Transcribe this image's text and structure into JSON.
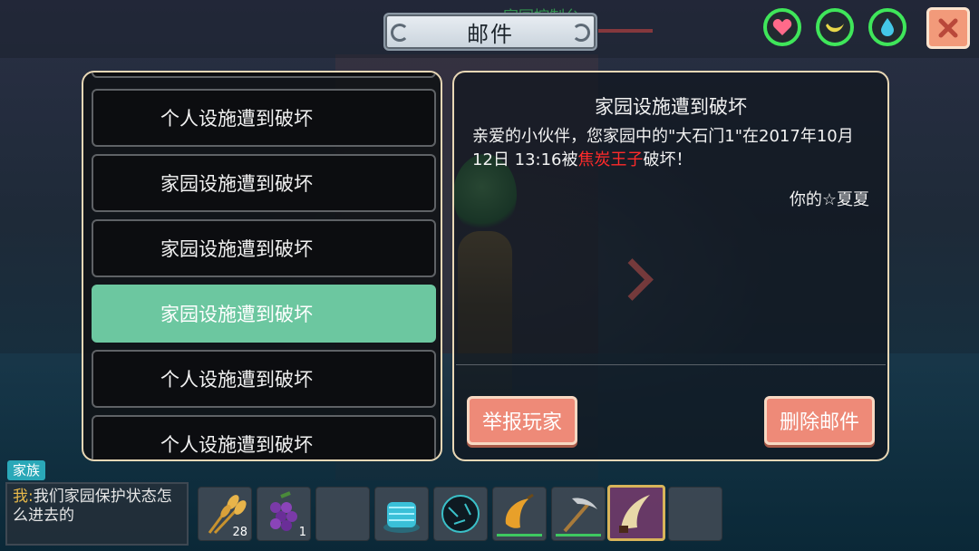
{
  "header": {
    "title": "邮件",
    "ghost_title": "家园控制台"
  },
  "status_icons": [
    "heart-icon",
    "banana-icon",
    "water-drop-icon"
  ],
  "close_icon": "close-x-icon",
  "mail_list": [
    {
      "label": "个人设施遭到破坏",
      "selected": false
    },
    {
      "label": "家园设施遭到破坏",
      "selected": false
    },
    {
      "label": "家园设施遭到破坏",
      "selected": false
    },
    {
      "label": "家园设施遭到破坏",
      "selected": true
    },
    {
      "label": "个人设施遭到破坏",
      "selected": false
    },
    {
      "label": "个人设施遭到破坏",
      "selected": false
    }
  ],
  "detail": {
    "title": "家园设施遭到破坏",
    "body_prefix": "亲爱的小伙伴，您家园中的\"大石门1\"在2017年10月12日 13:16被",
    "attacker": "焦炭王子",
    "body_suffix": "破坏！",
    "signature": "你的☆夏夏",
    "report_button": "举报玩家",
    "delete_button": "删除邮件"
  },
  "chat": {
    "channel": "家族",
    "sender": "我",
    "separator": ":",
    "message": "我们家园保护状态怎么进去的"
  },
  "hotbar": [
    {
      "icon": "wheat-icon",
      "count": "28"
    },
    {
      "icon": "grapes-icon",
      "count": "1"
    },
    {
      "icon": "empty-slot",
      "count": ""
    },
    {
      "icon": "spring-device-icon",
      "count": ""
    },
    {
      "icon": "dark-orb-icon",
      "count": ""
    },
    {
      "icon": "banana-icon",
      "count": ""
    },
    {
      "icon": "pickaxe-icon",
      "count": ""
    },
    {
      "icon": "claw-blade-icon",
      "count": ""
    },
    {
      "icon": "empty-slot",
      "count": ""
    }
  ],
  "colors": {
    "accent_green": "#6cc7a0",
    "button_salmon": "#ee8a78",
    "attacker_red": "#ff2a2a",
    "stat_ring": "#3fe65a"
  }
}
